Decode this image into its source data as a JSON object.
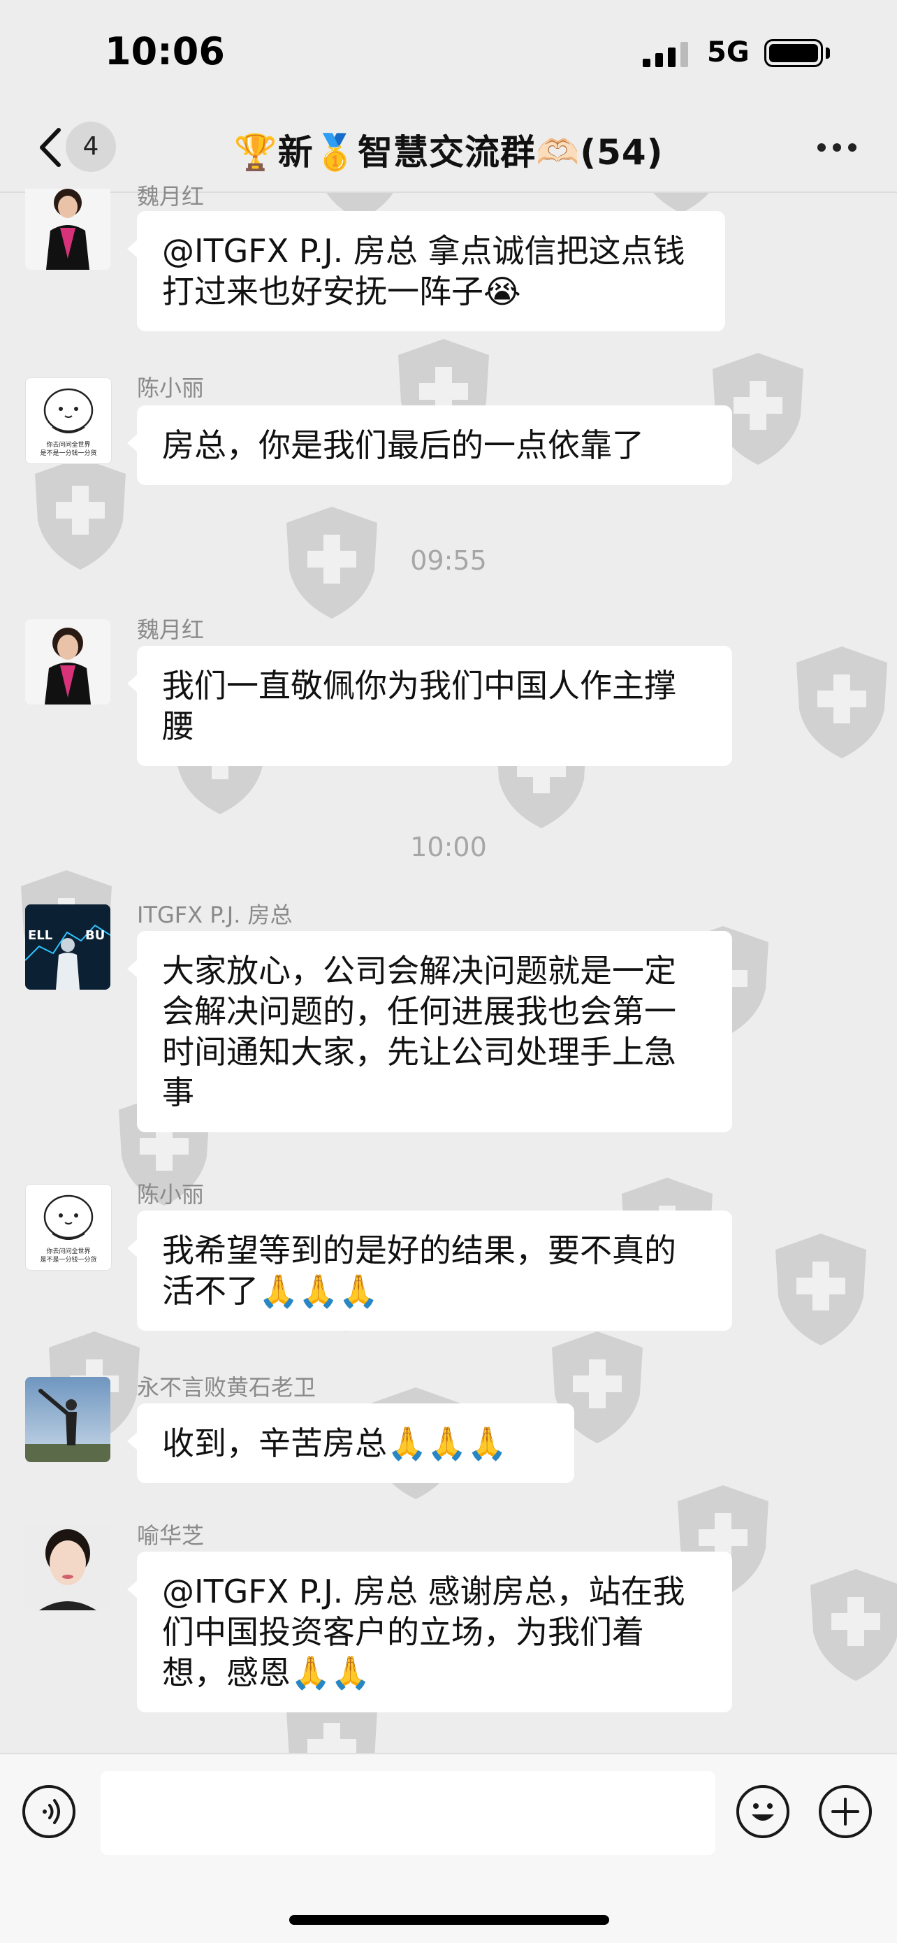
{
  "status_bar": {
    "time": "10:06",
    "network": "5G"
  },
  "header": {
    "back_count": "4",
    "title": "🏆新🥇智慧交流群🫶🏻(54)"
  },
  "messages": [
    {
      "sender": "魏月红",
      "text": "@ITGFX P.J. 房总 拿点诚信把这点钱打过来也好安抚一阵子😭"
    },
    {
      "sender": "陈小丽",
      "avatar_caption": "你去问问全世界\n是不是一分钱一分货",
      "text": "房总，你是我们最后的一点依靠了"
    },
    {
      "sender": "魏月红",
      "text": "我们一直敬佩你为我们中国人作主撑腰"
    },
    {
      "sender": "ITGFX P.J. 房总",
      "avatar_caption": "ELL BU",
      "text": "大家放心，公司会解决问题就是一定会解决问题的，任何进展我也会第一时间通知大家，先让公司处理手上急事"
    },
    {
      "sender": "陈小丽",
      "avatar_caption": "你去问问全世界\n是不是一分钱一分货",
      "text": "我希望等到的是好的结果，要不真的活不了🙏🙏🙏"
    },
    {
      "sender": "永不言败黄石老卫",
      "text": "收到，辛苦房总🙏🙏🙏"
    },
    {
      "sender": "喻华芝",
      "text": "@ITGFX P.J. 房总 感谢房总，站在我们中国投资客户的立场，为我们着想，感恩🙏🙏"
    }
  ],
  "timestamps": [
    "09:55",
    "10:00"
  ],
  "colors": {
    "background": "#ededed",
    "bubble": "#ffffff",
    "meta_text": "#8a8a8a"
  },
  "icons": [
    "back-chevron-icon",
    "more-icon",
    "voice-icon",
    "emoji-icon",
    "plus-icon",
    "watermark-shield-icon"
  ]
}
